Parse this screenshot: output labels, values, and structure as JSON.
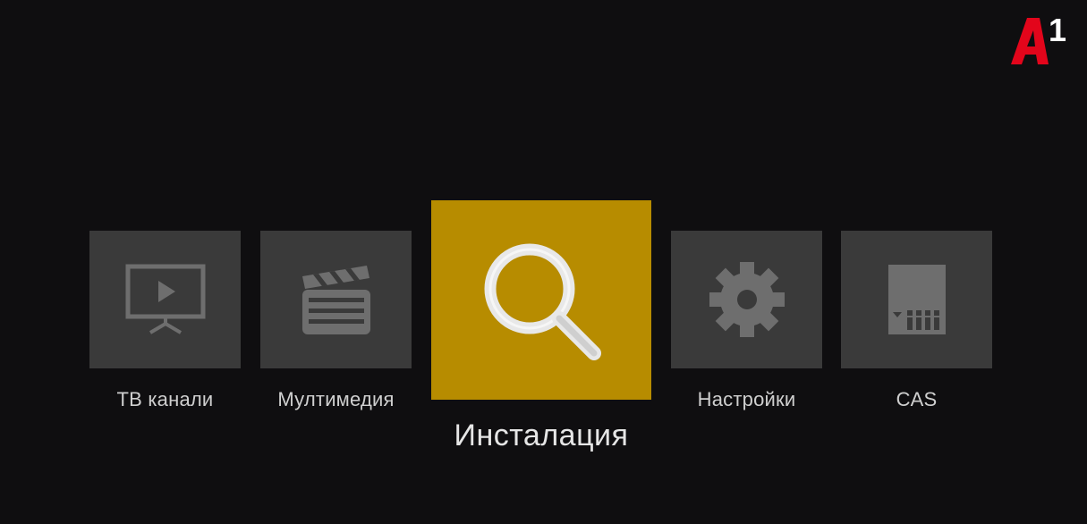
{
  "brand": {
    "logo_text": "A1",
    "logo_color": "#e3051b"
  },
  "menu": {
    "items": [
      {
        "label": "ТВ канали",
        "icon": "tv-icon",
        "selected": false
      },
      {
        "label": "Мултимедия",
        "icon": "clapperboard-icon",
        "selected": false
      },
      {
        "label": "Инсталация",
        "icon": "search-icon",
        "selected": true
      },
      {
        "label": "Настройки",
        "icon": "gear-icon",
        "selected": false
      },
      {
        "label": "CAS",
        "icon": "smartcard-icon",
        "selected": false
      }
    ],
    "tile_color": "#3a3a3a",
    "selected_color": "#b78c00"
  }
}
